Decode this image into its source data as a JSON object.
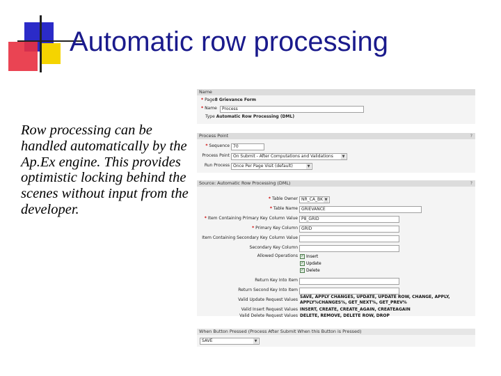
{
  "slide": {
    "title": "Automatic row processing",
    "body": "Row processing can be handled automatically by the Ap.Ex engine. This provides optimistic locking behind the scenes without input from the developer."
  },
  "colors": {
    "title": "#1a1a8c",
    "deco_blue": "#2b2bc8",
    "deco_red": "#e83040",
    "deco_yellow": "#f5d400",
    "panel_header": "#dcdcdc"
  },
  "name_panel": {
    "header": "Name",
    "page_label": "Page",
    "page_value": "8 Grievance Form",
    "name_label": "Name",
    "name_value": "Process",
    "type_label": "Type",
    "type_value": "Automatic Row Processing (DML)"
  },
  "process_point_panel": {
    "header": "Process Point",
    "help": "?",
    "sequence_label": "Sequence",
    "sequence_value": "70",
    "process_point_label": "Process Point",
    "process_point_value": "On Submit - After Computations and Validations",
    "run_process_label": "Run Process",
    "run_process_value": "Once Per Page Visit (default)"
  },
  "source_panel": {
    "header": "Source: Automatic Row Processing (DML)",
    "help": "?",
    "table_owner_label": "Table Owner",
    "table_owner_value": "NR_CA_BK",
    "table_name_label": "Table Name",
    "table_name_value": "GRIEVANCE",
    "pk_item_label": "Item Containing Primary Key Column Value",
    "pk_item_value": "P8_GRID",
    "pk_column_label": "Primary Key Column",
    "pk_column_value": "GRID",
    "sk_item_label": "Item Containing Secondary Key Column Value",
    "sk_item_value": "",
    "sk_column_label": "Secondary Key Column",
    "sk_column_value": "",
    "allowed_ops_label": "Allowed Operations",
    "ops": [
      "Insert",
      "Update",
      "Delete"
    ],
    "return_key_label": "Return Key Into Item",
    "return_key_value": "",
    "return_second_key_label": "Return Second Key Into Item",
    "return_second_key_value": "",
    "valid_update_label": "Valid Update Request Values",
    "valid_update_value_1": "SAVE, APPLY CHANGES, UPDATE, UPDATE ROW, CHANGE, APPLY,",
    "valid_update_value_2": "APPLY%CHANGES%, GET_NEXT%, GET_PREV%",
    "valid_insert_label": "Valid Insert Request Values",
    "valid_insert_value": "INSERT, CREATE, CREATE_AGAIN, CREATEAGAIN",
    "valid_delete_label": "Valid Delete Request Values",
    "valid_delete_value": "DELETE, REMOVE, DELETE ROW, DROP"
  },
  "button_panel": {
    "header": "When Button Pressed (Process After Submit When this Button is Pressed)",
    "value": "SAVE"
  }
}
